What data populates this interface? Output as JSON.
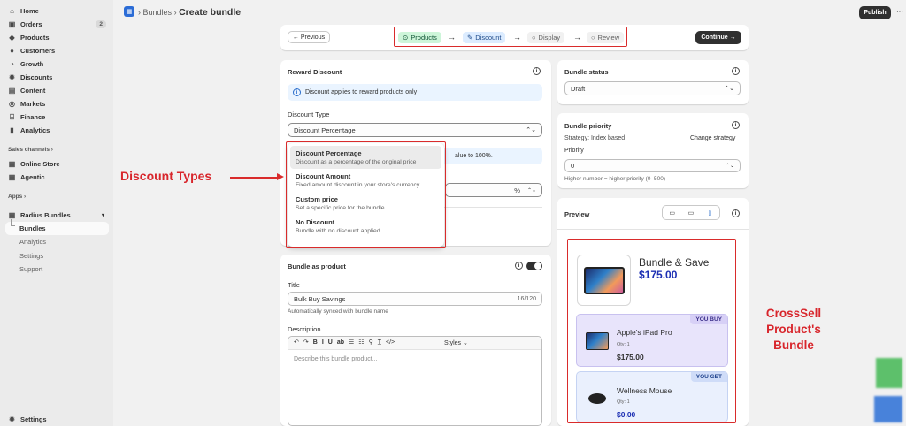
{
  "sidebar": {
    "main_items": [
      {
        "label": "Home",
        "icon": "home-icon",
        "glyph": "⌂"
      },
      {
        "label": "Orders",
        "icon": "orders-icon",
        "glyph": "▣",
        "badge": "2"
      },
      {
        "label": "Products",
        "icon": "tag-icon",
        "glyph": "◆"
      },
      {
        "label": "Customers",
        "icon": "person-icon",
        "glyph": "●"
      },
      {
        "label": "Growth",
        "icon": "growth-icon",
        "glyph": "◔"
      },
      {
        "label": "Discounts",
        "icon": "discount-icon",
        "glyph": "✹"
      },
      {
        "label": "Content",
        "icon": "content-icon",
        "glyph": "▤"
      },
      {
        "label": "Markets",
        "icon": "globe-icon",
        "glyph": "◎"
      },
      {
        "label": "Finance",
        "icon": "bank-icon",
        "glyph": "⌸"
      },
      {
        "label": "Analytics",
        "icon": "bar-chart-icon",
        "glyph": "▮"
      }
    ],
    "sales_channels_label": "Sales channels",
    "channels": [
      {
        "label": "Online Store",
        "icon": "store-icon",
        "glyph": "▦"
      },
      {
        "label": "Agentic",
        "icon": "agentic-icon",
        "glyph": "▦"
      }
    ],
    "apps_label": "Apps",
    "app_name": "Radius Bundles",
    "app_subitems": [
      "Bundles",
      "Analytics",
      "Settings",
      "Support"
    ],
    "settings_label": "Settings"
  },
  "header": {
    "breadcrumb_parent": "Bundles",
    "separator": "›",
    "title": "Create bundle",
    "publish_label": "Publish",
    "more": "···"
  },
  "stepper": {
    "previous_label": "← Previous",
    "continue_label": "Continue →",
    "steps": [
      "Products",
      "Discount",
      "Display",
      "Review"
    ],
    "arrow": "→"
  },
  "reward": {
    "title": "Reward Discount",
    "banner": "Discount applies to reward products only",
    "type_label": "Discount Type",
    "type_value": "Discount Percentage",
    "hidden_banner_tail": "alue to 100%.",
    "percent_suffix": "%",
    "options": [
      {
        "title": "Discount Percentage",
        "desc": "Discount as a percentage of the original price"
      },
      {
        "title": "Discount Amount",
        "desc": "Fixed amount discount in your store's currency"
      },
      {
        "title": "Custom price",
        "desc": "Set a specific price for the bundle"
      },
      {
        "title": "No Discount",
        "desc": "Bundle with no discount applied"
      }
    ]
  },
  "bundle_product": {
    "title": "Bundle as product",
    "title_label": "Title",
    "title_value": "Bulk Buy Savings",
    "title_count": "16/120",
    "sync_note": "Automatically synced with bundle name",
    "description_label": "Description",
    "description_placeholder": "Describe this bundle product...",
    "toolbar": [
      "↶",
      "↷",
      "B",
      "I",
      "U",
      "ab",
      "☰",
      "☷",
      "⚲",
      "T̲",
      "</>"
    ],
    "styles_label": "Styles"
  },
  "status": {
    "title": "Bundle status",
    "value": "Draft"
  },
  "priority": {
    "title": "Bundle priority",
    "strategy": "Strategy: Index based",
    "change_link": "Change strategy",
    "label": "Priority",
    "value": "0",
    "hint": "Higher number = higher priority (0–500)"
  },
  "preview": {
    "title": "Preview",
    "bundle_title": "Bundle & Save",
    "bundle_price": "$175.00",
    "items": [
      {
        "tag": "YOU BUY",
        "name": "Apple's iPad Pro",
        "qty": "Qty: 1",
        "price": "$175.00"
      },
      {
        "tag": "YOU GET",
        "name": "Wellness Mouse",
        "qty": "Qty: 1",
        "price": "$0.00"
      }
    ]
  },
  "annotations": {
    "discount_types": "Discount Types",
    "crosssell_line1": "CrossSell Product's",
    "crosssell_line2": "Bundle"
  },
  "colors": {
    "annotation_red": "#d92b2b",
    "price_blue": "#1c2fb3",
    "step_active_green": "#cdf5d9",
    "step_active_blue": "#dcecff",
    "you_buy_bg": "#e8e4fb"
  }
}
